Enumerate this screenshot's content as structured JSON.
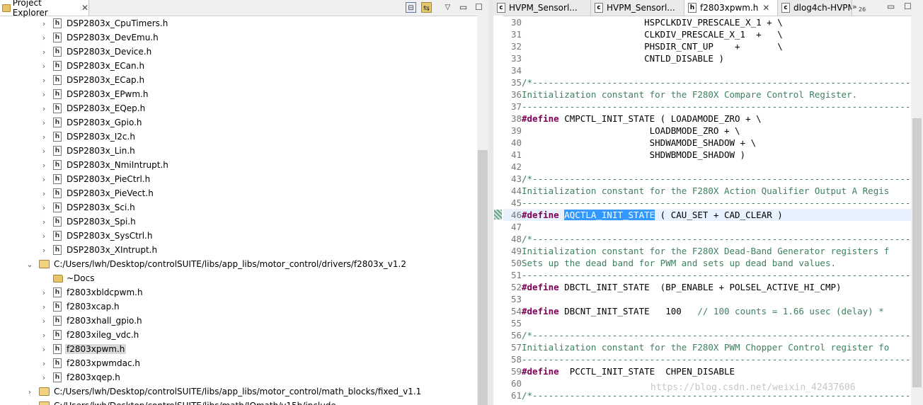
{
  "explorer": {
    "tab_label": "Project Explorer",
    "tab_close": "✕",
    "toolbar": {
      "collapse": "⊟",
      "link": "⇆",
      "view_menu": "▽",
      "minimize": "▭",
      "maximize": "☐"
    },
    "rows": [
      {
        "label": "DSP2803x_CpuTimers.h",
        "type": "file",
        "expander": "›",
        "selected": false,
        "level": 2
      },
      {
        "label": "DSP2803x_DevEmu.h",
        "type": "file",
        "expander": "›",
        "selected": false,
        "level": 2
      },
      {
        "label": "DSP2803x_Device.h",
        "type": "file",
        "expander": "›",
        "selected": false,
        "level": 2
      },
      {
        "label": "DSP2803x_ECan.h",
        "type": "file",
        "expander": "›",
        "selected": false,
        "level": 2
      },
      {
        "label": "DSP2803x_ECap.h",
        "type": "file",
        "expander": "›",
        "selected": false,
        "level": 2
      },
      {
        "label": "DSP2803x_EPwm.h",
        "type": "file",
        "expander": "›",
        "selected": false,
        "level": 2
      },
      {
        "label": "DSP2803x_EQep.h",
        "type": "file",
        "expander": "›",
        "selected": false,
        "level": 2
      },
      {
        "label": "DSP2803x_Gpio.h",
        "type": "file",
        "expander": "›",
        "selected": false,
        "level": 2
      },
      {
        "label": "DSP2803x_I2c.h",
        "type": "file",
        "expander": "›",
        "selected": false,
        "level": 2
      },
      {
        "label": "DSP2803x_Lin.h",
        "type": "file",
        "expander": "›",
        "selected": false,
        "level": 2
      },
      {
        "label": "DSP2803x_NmiIntrupt.h",
        "type": "file",
        "expander": "›",
        "selected": false,
        "level": 2
      },
      {
        "label": "DSP2803x_PieCtrl.h",
        "type": "file",
        "expander": "›",
        "selected": false,
        "level": 2
      },
      {
        "label": "DSP2803x_PieVect.h",
        "type": "file",
        "expander": "›",
        "selected": false,
        "level": 2
      },
      {
        "label": "DSP2803x_Sci.h",
        "type": "file",
        "expander": "›",
        "selected": false,
        "level": 2
      },
      {
        "label": "DSP2803x_Spi.h",
        "type": "file",
        "expander": "›",
        "selected": false,
        "level": 2
      },
      {
        "label": "DSP2803x_SysCtrl.h",
        "type": "file",
        "expander": "›",
        "selected": false,
        "level": 2
      },
      {
        "label": "DSP2803x_XIntrupt.h",
        "type": "file",
        "expander": "›",
        "selected": false,
        "level": 2
      },
      {
        "label": "C:/Users/lwh/Desktop/controlSUITE/libs/app_libs/motor_control/drivers/f2803x_v1.2",
        "type": "folder-open",
        "expander": "⌄",
        "selected": false,
        "level": 1
      },
      {
        "label": "~Docs",
        "type": "folder",
        "expander": "",
        "selected": false,
        "level": 2
      },
      {
        "label": "f2803xbldcpwm.h",
        "type": "file",
        "expander": "›",
        "selected": false,
        "level": 2
      },
      {
        "label": "f2803xcap.h",
        "type": "file",
        "expander": "›",
        "selected": false,
        "level": 2
      },
      {
        "label": "f2803xhall_gpio.h",
        "type": "file",
        "expander": "›",
        "selected": false,
        "level": 2
      },
      {
        "label": "f2803xileg_vdc.h",
        "type": "file",
        "expander": "›",
        "selected": false,
        "level": 2
      },
      {
        "label": "f2803xpwm.h",
        "type": "file",
        "expander": "›",
        "selected": true,
        "level": 2
      },
      {
        "label": "f2803xpwmdac.h",
        "type": "file",
        "expander": "›",
        "selected": false,
        "level": 2
      },
      {
        "label": "f2803xqep.h",
        "type": "file",
        "expander": "›",
        "selected": false,
        "level": 2
      },
      {
        "label": "C:/Users/lwh/Desktop/controlSUITE/libs/app_libs/motor_control/math_blocks/fixed_v1.1",
        "type": "folder-open",
        "expander": "›",
        "selected": false,
        "level": 1
      },
      {
        "label": "C:/Users/lwh/Desktop/controlSUITE/libs/math/IQmath/v15b/include",
        "type": "folder-open",
        "expander": "›",
        "selected": false,
        "level": 1
      }
    ]
  },
  "editor": {
    "tabs": [
      {
        "label": "HVPM_Sensorl...",
        "active": false,
        "close": ""
      },
      {
        "label": "HVPM_Sensorl...",
        "active": false,
        "close": ""
      },
      {
        "label": "f2803xpwm.h",
        "active": true,
        "close": "✕"
      },
      {
        "label": "dlog4ch-HVPM...",
        "active": false,
        "close": ""
      }
    ],
    "overflow_icon": "»",
    "overflow_count": "26",
    "minimize": "▭",
    "maximize": "☐",
    "code": [
      {
        "n": "30",
        "segs": [
          {
            "t": "                       HSPCLKDIV_PRESCALE_X_1 + \\",
            "c": ""
          }
        ]
      },
      {
        "n": "31",
        "segs": [
          {
            "t": "                       CLKDIV_PRESCALE_X_1  +   \\",
            "c": ""
          }
        ]
      },
      {
        "n": "32",
        "segs": [
          {
            "t": "                       PHSDIR_CNT_UP    +       \\",
            "c": ""
          }
        ]
      },
      {
        "n": "33",
        "segs": [
          {
            "t": "                       CNTLD_DISABLE )",
            "c": ""
          }
        ]
      },
      {
        "n": "34",
        "segs": []
      },
      {
        "n": "35",
        "segs": [
          {
            "t": "/*-------------------------------------------------------------------------",
            "c": "cm"
          }
        ]
      },
      {
        "n": "36",
        "segs": [
          {
            "t": "Initialization constant for the F280X Compare Control Register.",
            "c": "cm"
          }
        ]
      },
      {
        "n": "37",
        "segs": [
          {
            "t": "---------------------------------------------------------------------------",
            "c": "cm"
          }
        ]
      },
      {
        "n": "38",
        "segs": [
          {
            "t": "#define",
            "c": "kw"
          },
          {
            "t": " CMPCTL_INIT_STATE ( LOADAMODE_ZRO + \\",
            "c": ""
          }
        ]
      },
      {
        "n": "39",
        "segs": [
          {
            "t": "                        LOADBMODE_ZRO + \\",
            "c": ""
          }
        ]
      },
      {
        "n": "40",
        "segs": [
          {
            "t": "                        SHDWAMODE_SHADOW + \\",
            "c": ""
          }
        ]
      },
      {
        "n": "41",
        "segs": [
          {
            "t": "                        SHDWBMODE_SHADOW )",
            "c": ""
          }
        ]
      },
      {
        "n": "42",
        "segs": []
      },
      {
        "n": "43",
        "segs": [
          {
            "t": "/*-------------------------------------------------------------------------",
            "c": "cm"
          }
        ]
      },
      {
        "n": "44",
        "segs": [
          {
            "t": "Initialization constant for the F280X Action Qualifier Output A Regis",
            "c": "cm"
          }
        ]
      },
      {
        "n": "45",
        "segs": [
          {
            "t": "---------------------------------------------------------------------------",
            "c": "cm"
          }
        ]
      },
      {
        "n": "46",
        "current": true,
        "segs": [
          {
            "t": "#define",
            "c": "kw"
          },
          {
            "t": " ",
            "c": ""
          },
          {
            "t": "AQCTLA_INIT_STATE",
            "c": "hl"
          },
          {
            "t": " ( CAU_SET + CAD_CLEAR )",
            "c": ""
          }
        ]
      },
      {
        "n": "47",
        "segs": []
      },
      {
        "n": "48",
        "segs": [
          {
            "t": "/*-------------------------------------------------------------------------",
            "c": "cm"
          }
        ]
      },
      {
        "n": "49",
        "segs": [
          {
            "t": "Initialization constant for the F280X Dead-Band Generator registers f",
            "c": "cm"
          }
        ]
      },
      {
        "n": "50",
        "segs": [
          {
            "t": "Sets up the dead band for PWM and sets up dead band values.",
            "c": "cm"
          }
        ]
      },
      {
        "n": "51",
        "segs": [
          {
            "t": "---------------------------------------------------------------------------",
            "c": "cm"
          }
        ]
      },
      {
        "n": "52",
        "segs": [
          {
            "t": "#define",
            "c": "kw"
          },
          {
            "t": " DBCTL_INIT_STATE  (BP_ENABLE + POLSEL_ACTIVE_HI_CMP)",
            "c": ""
          }
        ]
      },
      {
        "n": "53",
        "segs": []
      },
      {
        "n": "54",
        "segs": [
          {
            "t": "#define",
            "c": "kw"
          },
          {
            "t": " DBCNT_INIT_STATE   100   ",
            "c": ""
          },
          {
            "t": "// 100 counts = 1.66 usec (delay) *",
            "c": "cm"
          }
        ]
      },
      {
        "n": "55",
        "segs": []
      },
      {
        "n": "56",
        "segs": [
          {
            "t": "/*-------------------------------------------------------------------------",
            "c": "cm"
          }
        ]
      },
      {
        "n": "57",
        "segs": [
          {
            "t": "Initialization constant for the F280X PWM Chopper Control register fo",
            "c": "cm"
          }
        ]
      },
      {
        "n": "58",
        "segs": [
          {
            "t": "---------------------------------------------------------------------------",
            "c": "cm"
          }
        ]
      },
      {
        "n": "59",
        "segs": [
          {
            "t": "#define",
            "c": "kw"
          },
          {
            "t": "  PCCTL_INIT_STATE  CHPEN_DISABLE",
            "c": ""
          }
        ]
      },
      {
        "n": "60",
        "segs": []
      },
      {
        "n": "61",
        "segs": [
          {
            "t": "/*-------------------------------------------------------------------------",
            "c": "cm"
          }
        ]
      }
    ],
    "watermark": "https://blog.csdn.net/weixin_42437606"
  }
}
